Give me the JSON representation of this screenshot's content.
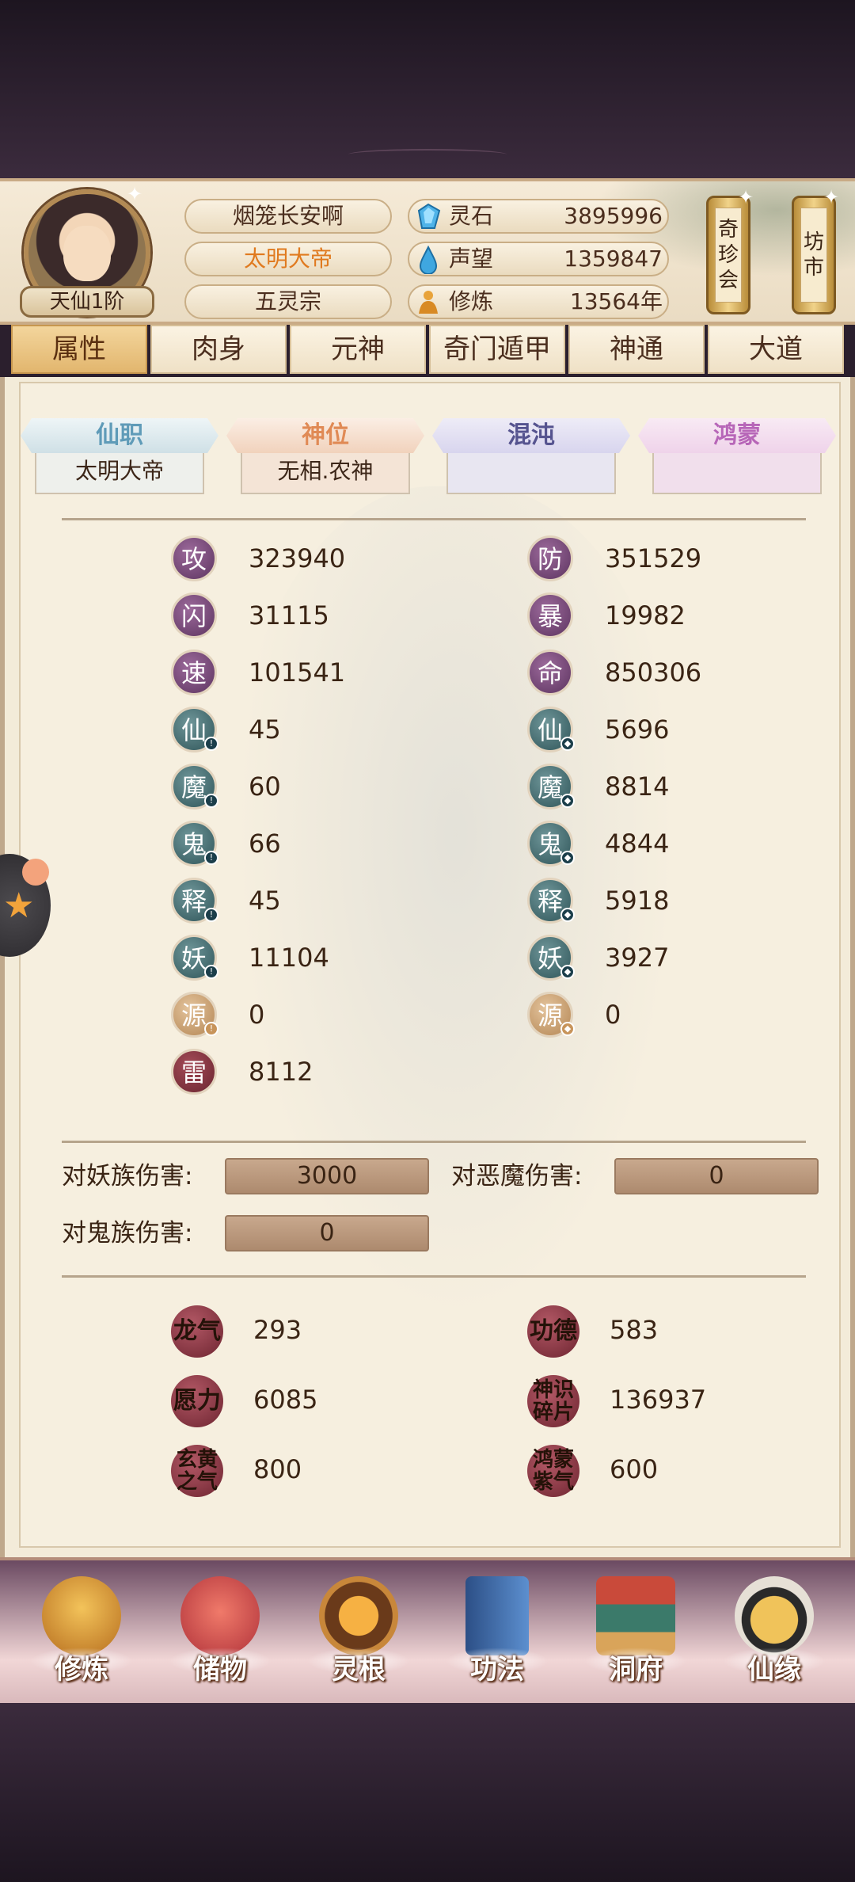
{
  "header": {
    "realm_badge": "天仙1阶",
    "player_name": "烟笼长安啊",
    "title": "太明大帝",
    "sect": "五灵宗",
    "resources": [
      {
        "icon": "crystal-icon",
        "label": "灵石",
        "value": "3895996"
      },
      {
        "icon": "water-drop-icon",
        "label": "声望",
        "value": "1359847"
      },
      {
        "icon": "meditation-icon",
        "label": "修炼",
        "value": "13564年"
      }
    ],
    "side_buttons": [
      {
        "label": "奇珍会",
        "chars": [
          "奇",
          "珍",
          "会"
        ]
      },
      {
        "label": "坊市",
        "chars": [
          "坊",
          "市"
        ]
      }
    ]
  },
  "tabs": [
    "属性",
    "肉身",
    "元神",
    "奇门遁甲",
    "神通",
    "大道"
  ],
  "active_tab": 0,
  "banners": [
    {
      "title": "仙职",
      "sub": "太明大帝",
      "color": "#6fa0b8"
    },
    {
      "title": "神位",
      "sub": "无相.农神",
      "color": "#e08a55"
    },
    {
      "title": "混沌",
      "sub": "",
      "color": "#6d6ab0"
    },
    {
      "title": "鸿蒙",
      "sub": "",
      "color": "#b766b8"
    }
  ],
  "stats_left": [
    {
      "icon": "攻",
      "value": "323940"
    },
    {
      "icon": "闪",
      "value": "31115"
    },
    {
      "icon": "速",
      "value": "101541"
    },
    {
      "icon": "仙",
      "value": "45"
    },
    {
      "icon": "魔",
      "value": "60"
    },
    {
      "icon": "鬼",
      "value": "66"
    },
    {
      "icon": "释",
      "value": "45"
    },
    {
      "icon": "妖",
      "value": "11104"
    },
    {
      "icon": "源",
      "value": "0"
    },
    {
      "icon": "雷",
      "value": "8112"
    }
  ],
  "stats_right": [
    {
      "icon": "防",
      "value": "351529"
    },
    {
      "icon": "暴",
      "value": "19982"
    },
    {
      "icon": "命",
      "value": "850306"
    },
    {
      "icon": "仙",
      "value": "5696"
    },
    {
      "icon": "魔",
      "value": "8814"
    },
    {
      "icon": "鬼",
      "value": "4844"
    },
    {
      "icon": "释",
      "value": "5918"
    },
    {
      "icon": "妖",
      "value": "3927"
    },
    {
      "icon": "源",
      "value": "0"
    }
  ],
  "damage": {
    "yao_label": "对妖族伤害:",
    "yao_value": "3000",
    "emo_label": "对恶魔伤害:",
    "emo_value": "0",
    "gui_label": "对鬼族伤害:",
    "gui_value": "0"
  },
  "extras": [
    {
      "label": "龙气",
      "value": "293"
    },
    {
      "label": "功德",
      "value": "583"
    },
    {
      "label": "愿力",
      "value": "6085"
    },
    {
      "label": "神识碎片",
      "value": "136937"
    },
    {
      "label": "玄黄之气",
      "value": "800"
    },
    {
      "label": "鸿蒙紫气",
      "value": "600"
    }
  ],
  "bottom_nav": [
    "修炼",
    "储物",
    "灵根",
    "功法",
    "洞府",
    "仙缘"
  ]
}
